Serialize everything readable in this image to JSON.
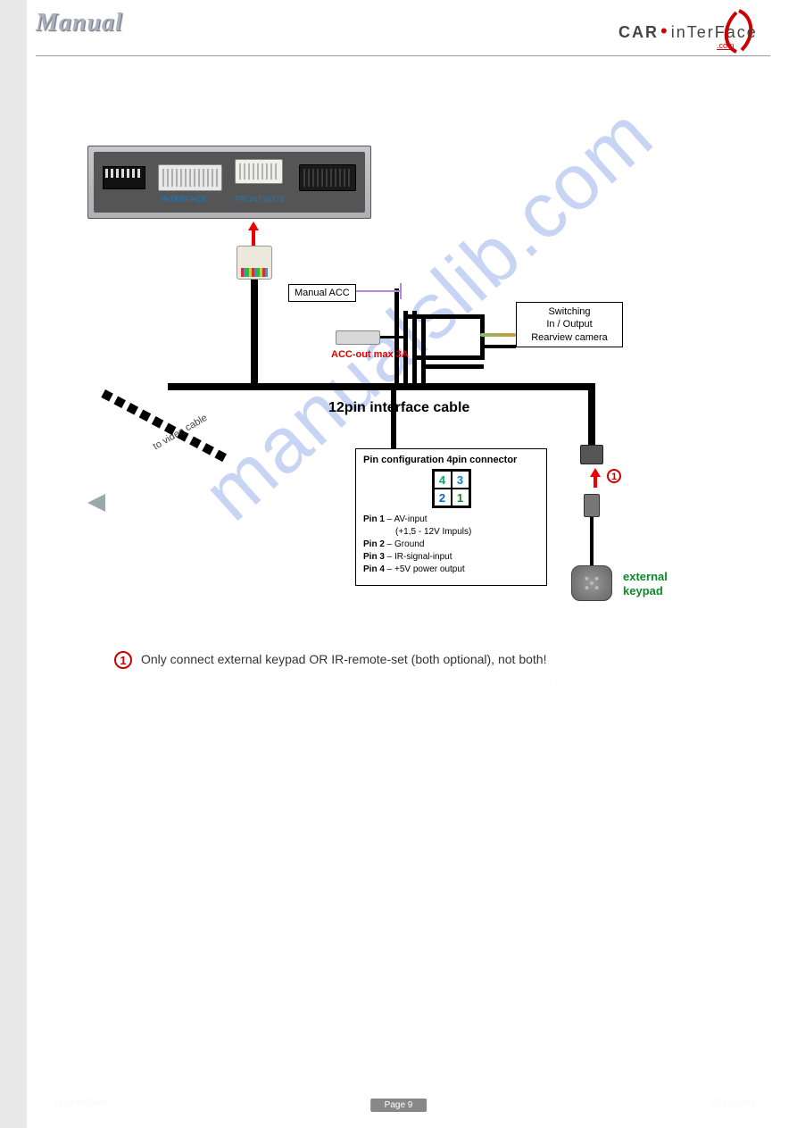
{
  "header": {
    "title": "Manual"
  },
  "logo": {
    "brand_a": "CAR",
    "brand_b": "inTerFace",
    "tld": ".com"
  },
  "watermark": "manualslib.com",
  "diagram": {
    "ifbox": {
      "label_interface": "INTERFACE",
      "label_front": "FRONTSEITE"
    },
    "cable_title": "12pin interface cable",
    "video_cable_label": "to video cable",
    "manual_acc": "Manual ACC",
    "acc_out": "ACC-out max 3A",
    "switching_box": {
      "l1": "Switching",
      "l2": "In / Output",
      "l3": "Rearview camera"
    },
    "keypad": {
      "l1": "external",
      "l2": "keypad"
    },
    "marker_keypad": "1",
    "pinbox": {
      "title": "Pin configuration 4pin connector",
      "grid": {
        "p4": "4",
        "p3": "3",
        "p2": "2",
        "p1": "1"
      },
      "pin1_a": "Pin 1",
      "pin1_b": " – AV-input",
      "pin1_c": "(+1,5 - 12V Impuls)",
      "pin2_a": "Pin 2",
      "pin2_b": " – Ground",
      "pin3_a": "Pin 3",
      "pin3_b": " – IR-signal-input",
      "pin4_a": "Pin 4",
      "pin4_b": " – +5V power output"
    }
  },
  "note": {
    "marker": "1",
    "line1": "Only connect external keypad OR IR-remote-set (both optional), not both!",
    "line2": "It is possible to connect the keypad at a later stage, as both video interface and the keypad remember the last status."
  },
  "footer": {
    "left": "HDV-MBN45",
    "right": "2013-04-17"
  },
  "page_number": "Page 9"
}
